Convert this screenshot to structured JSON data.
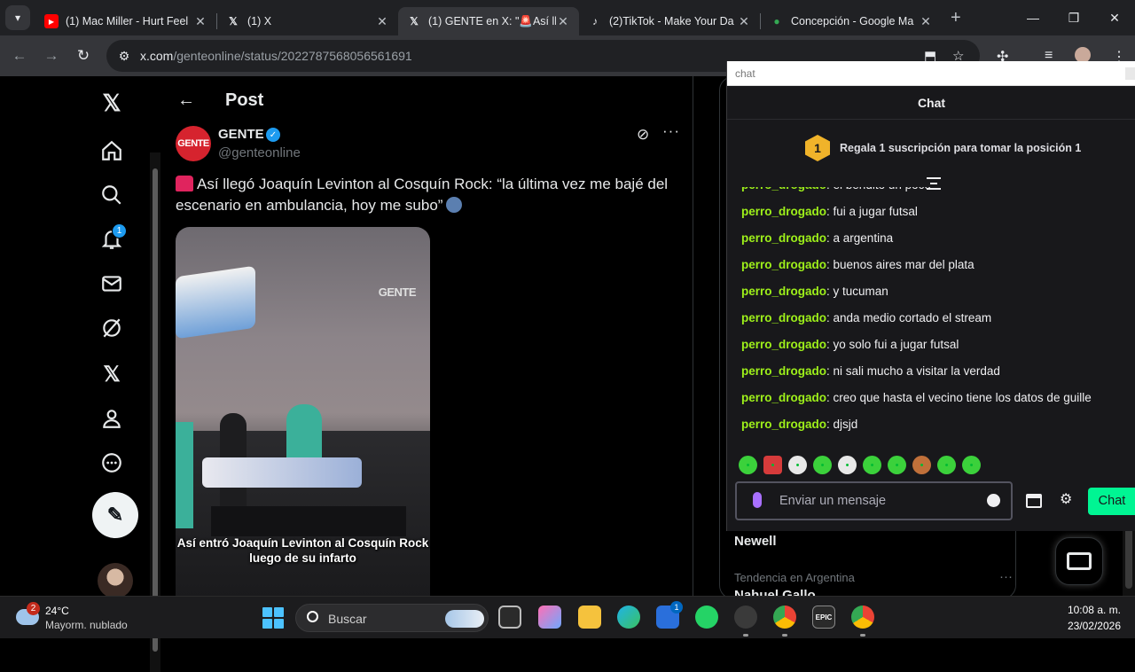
{
  "browser": {
    "tabs": [
      {
        "title": "(1) Mac Miller - Hurt Feel",
        "favicon": "youtube-icon",
        "color": "#ff0000",
        "active": false
      },
      {
        "title": "(1) X",
        "favicon": "x-logo-icon",
        "color": "#ffffff",
        "active": false
      },
      {
        "title": "(1) GENTE en X: \"🚨Así ll",
        "favicon": "x-logo-icon",
        "color": "#ffffff",
        "active": true
      },
      {
        "title": "(2)TikTok - Make Your Da",
        "favicon": "tiktok-icon",
        "color": "#ffffff",
        "active": false
      },
      {
        "title": "Concepción - Google Ma",
        "favicon": "google-maps-icon",
        "color": "#34a853",
        "active": false
      }
    ],
    "url_host": "x.com",
    "url_path": "/genteonline/status/2022787568056561691"
  },
  "x_nav": {
    "notification_count": "1"
  },
  "post": {
    "header_title": "Post",
    "author_name": "GENTE",
    "author_handle": "@genteonline",
    "avatar_text": "GENTE",
    "text": "Así llegó Joaquín Levinton al Cosquín Rock: “la última vez me bajé del escenario en ambulancia, hoy me subo”",
    "media_watermark": "GENTE",
    "media_caption": "Así entró Joaquín Levinton al Cosquín Rock luego de su infarto"
  },
  "sidebar_trends": {
    "team": "Newell",
    "context": "Tendencia en Argentina",
    "name": "Nahuel Gallo"
  },
  "chat_popup": {
    "window_title": "chat",
    "header": "Chat",
    "sub_position": "1",
    "sub_text": "Regala 1 suscripción para tomar la posición 1",
    "username_color": "#9ef01a",
    "messages": [
      {
        "user": "perro_drogado",
        "text": "el bendito un poco"
      },
      {
        "user": "perro_drogado",
        "text": "fui a jugar futsal"
      },
      {
        "user": "perro_drogado",
        "text": "a argentina"
      },
      {
        "user": "perro_drogado",
        "text": "buenos aires mar del plata"
      },
      {
        "user": "perro_drogado",
        "text": "y tucuman"
      },
      {
        "user": "perro_drogado",
        "text": "anda medio cortado el stream"
      },
      {
        "user": "perro_drogado",
        "text": "yo solo fui a jugar futsal"
      },
      {
        "user": "perro_drogado",
        "text": "ni sali mucho a visitar la verdad"
      },
      {
        "user": "perro_drogado",
        "text": "creo que hasta el vecino tiene los datos de guille"
      },
      {
        "user": "perro_drogado",
        "text": "djsjd"
      }
    ],
    "input_placeholder": "Enviar un mensaje",
    "send_label": "Chat"
  },
  "taskbar": {
    "weather_alerts": "2",
    "temperature": "24°C",
    "weather_desc": "Mayorm. nublado",
    "search_label": "Buscar",
    "store_badge": "1",
    "time": "10:08 a. m.",
    "date": "23/02/2026",
    "epic_label": "EPIC"
  }
}
